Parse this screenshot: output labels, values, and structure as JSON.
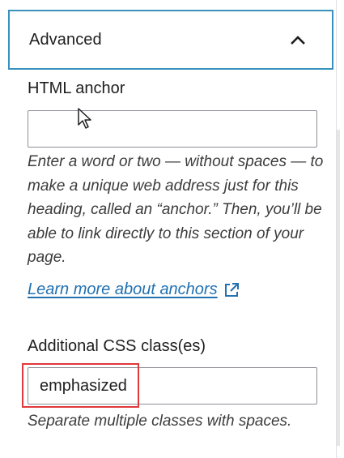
{
  "section": {
    "title": "Advanced",
    "expanded": true
  },
  "anchor_field": {
    "label": "HTML anchor",
    "value": "",
    "help": "Enter a word or two — without spaces — to make a unique web address just for this heading, called an “anchor.” Then, you’ll be able to link directly to this section of your page."
  },
  "learn_more": {
    "label": "Learn more about anchors",
    "icon": "external-link-icon"
  },
  "css_field": {
    "label": "Additional CSS class(es)",
    "value": "emphasized",
    "help": "Separate multiple classes with spaces."
  },
  "colors": {
    "focus_border": "#3892bd",
    "link": "#2271b1",
    "highlight": "#e0393b"
  }
}
